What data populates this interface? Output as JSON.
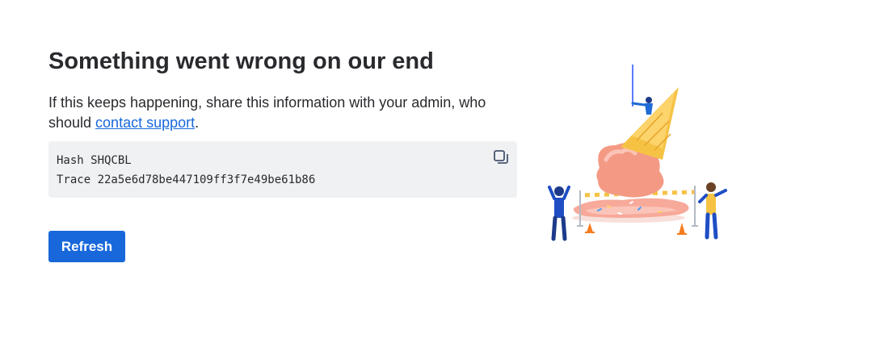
{
  "error": {
    "title": "Something went wrong on our end",
    "description_prefix": "If this keeps happening, share this information with your admin, who should ",
    "support_link_label": "contact support",
    "description_suffix": ".",
    "hash_line": "Hash SHQCBL",
    "trace_line": "Trace 22a5e6d78be447109ff3f7e49be61b86",
    "refresh_label": "Refresh"
  },
  "icons": {
    "copy": "copy-icon",
    "illustration": "melted-ice-cream-illustration"
  },
  "colors": {
    "primary": "#1868db",
    "text": "#292a2e",
    "code_background": "#f0f1f2"
  }
}
